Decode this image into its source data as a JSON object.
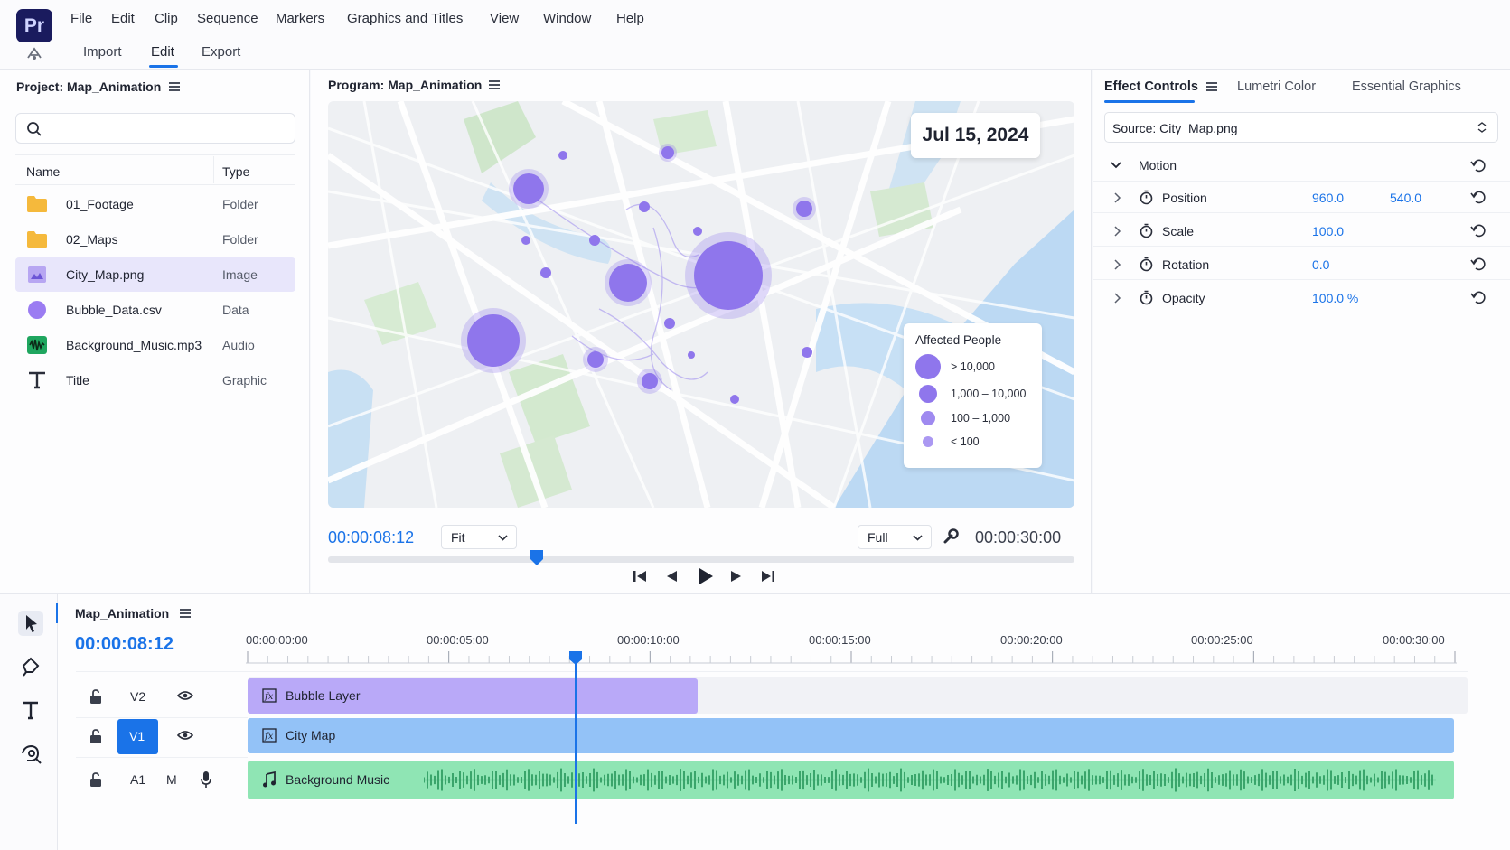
{
  "app": {
    "logo": "Pr"
  },
  "menu": [
    "File",
    "Edit",
    "Clip",
    "Sequence",
    "Markers",
    "Graphics and Titles",
    "View",
    "Window",
    "Help"
  ],
  "workspaces": {
    "import": "Import",
    "edit": "Edit",
    "export": "Export"
  },
  "project": {
    "title": "Project: Map_Animation",
    "search_placeholder": "",
    "columns": {
      "name": "Name",
      "type": "Type"
    },
    "items": [
      {
        "name": "01_Footage",
        "type": "Folder",
        "icon": "folder-icon"
      },
      {
        "name": "02_Maps",
        "type": "Folder",
        "icon": "folder-icon"
      },
      {
        "name": "City_Map.png",
        "type": "Image",
        "icon": "image-icon",
        "selected": true
      },
      {
        "name": "Bubble_Data.csv",
        "type": "Data",
        "icon": "data-circle-icon"
      },
      {
        "name": "Background_Music.mp3",
        "type": "Audio",
        "icon": "audio-waveform-icon"
      },
      {
        "name": "Title",
        "type": "Graphic",
        "icon": "text-graphic-icon"
      }
    ]
  },
  "program": {
    "title": "Program: Map_Animation",
    "date_overlay": "Jul 15, 2024",
    "legend": {
      "title": "Affected People",
      "items": [
        "> 10,000",
        "1,000 – 10,000",
        "100 – 1,000",
        "< 100"
      ]
    },
    "timecode_current": "00:00:08:12",
    "fit_select": "Fit",
    "quality_select": "Full",
    "timecode_duration": "00:00:30:00",
    "playhead_fraction": 0.28
  },
  "effects": {
    "tabs": [
      "Effect Controls",
      "Lumetri Color",
      "Essential Graphics"
    ],
    "source": "Source: City_Map.png",
    "section": "Motion",
    "properties": [
      {
        "label": "Position",
        "values": [
          "960.0",
          "540.0"
        ]
      },
      {
        "label": "Scale",
        "values": [
          "100.0"
        ]
      },
      {
        "label": "Rotation",
        "values": [
          "0.0"
        ]
      },
      {
        "label": "Opacity",
        "values": [
          "100.0 %"
        ]
      }
    ]
  },
  "timeline": {
    "title": "Map_Animation",
    "timecode": "00:00:08:12",
    "ruler": [
      "00:00:00:00",
      "00:00:05:00",
      "00:00:10:00",
      "00:00:15:00",
      "00:00:20:00",
      "00:00:25:00",
      "00:00:30:00"
    ],
    "tracks": {
      "v2": "V2",
      "v1": "V1",
      "a1": "A1",
      "mute": "M"
    },
    "clips": {
      "bubble": "Bubble Layer",
      "city": "City Map",
      "music": "Background Music"
    },
    "colors": {
      "bubble": "#b9a9f8",
      "city": "#93c2f7",
      "music": "#8fe5b4",
      "accent": "#1a73e8"
    }
  }
}
